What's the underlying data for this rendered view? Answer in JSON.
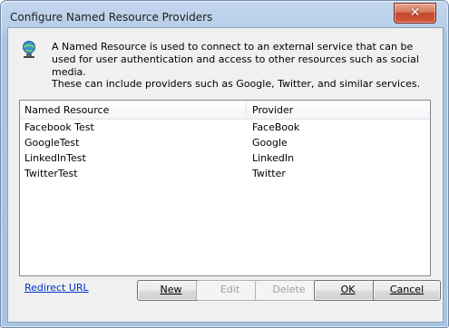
{
  "window": {
    "title": "Configure Named Resource Providers",
    "close_glyph": "✕"
  },
  "info": {
    "icon": "globe-user-icon",
    "description": "A Named Resource is used to connect to an external service that can be used for user authentication and access to other resources such as social media.",
    "note": "These can include providers such as Google, Twitter, and similar services."
  },
  "table": {
    "columns": [
      "Named Resource",
      "Provider"
    ],
    "rows": [
      {
        "name": "Facebook Test",
        "provider": "FaceBook"
      },
      {
        "name": "GoogleTest",
        "provider": "Google"
      },
      {
        "name": "LinkedInTest",
        "provider": "LinkedIn"
      },
      {
        "name": "TwitterTest",
        "provider": "Twitter"
      }
    ]
  },
  "footer": {
    "redirect_link": "Redirect URL",
    "buttons": {
      "new": "New",
      "edit": "Edit",
      "delete": "Delete",
      "ok": "OK",
      "cancel": "Cancel"
    }
  }
}
